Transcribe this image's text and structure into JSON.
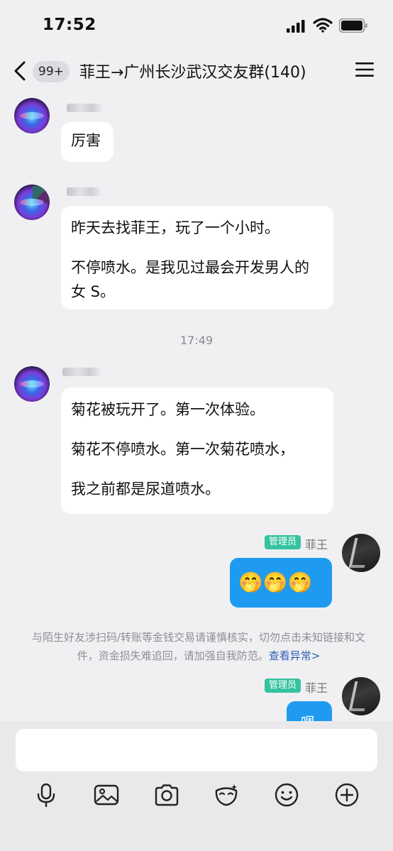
{
  "status_bar": {
    "time": "17:52"
  },
  "header": {
    "unread_badge": "99+",
    "title": "菲王→广州长沙武汉交友群(140)"
  },
  "messages": [
    {
      "text": "厉害"
    },
    {
      "paragraphs": [
        "昨天去找菲王，玩了一个小时。",
        "不停喷水。是我见过最会开发男人的女 S。"
      ]
    },
    {
      "paragraphs": [
        "菊花被玩开了。第一次体验。",
        "菊花不停喷水。第一次菊花喷水，",
        "我之前都是尿道喷水。"
      ]
    }
  ],
  "timestamp": "17:49",
  "admin": {
    "role": "管理员",
    "name": "菲王"
  },
  "emoji_message": "🤭🤭🤭",
  "partial_message": "嗯",
  "notice": {
    "text": "与陌生好友涉扫码/转账等金钱交易请谨慎核实，切勿点击未知链接和文件，资金损失难追回，请加强自我防范。",
    "link": "查看异常>"
  },
  "input": {
    "placeholder": ""
  },
  "toolbar": [
    "microphone-icon",
    "image-icon",
    "camera-icon",
    "mask-icon",
    "emoji-face-icon",
    "plus-icon"
  ]
}
